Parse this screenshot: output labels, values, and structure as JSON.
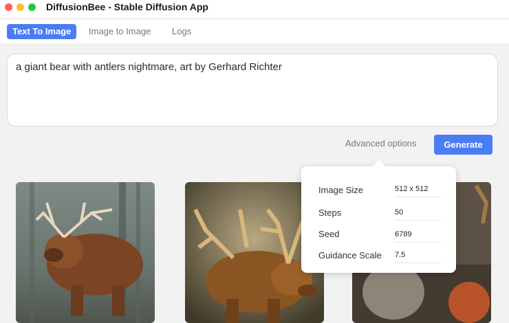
{
  "window": {
    "title": "DiffusionBee - Stable Diffusion App"
  },
  "tabs": [
    {
      "label": "Text To Image",
      "active": true
    },
    {
      "label": "Image to Image",
      "active": false
    },
    {
      "label": "Logs",
      "active": false
    }
  ],
  "prompt": {
    "value": "a giant bear with antlers nightmare, art by Gerhard Richter"
  },
  "controls": {
    "advanced_label": "Advanced options",
    "generate_label": "Generate"
  },
  "advanced": {
    "image_size_label": "Image Size",
    "image_size_value": "512 x 512",
    "steps_label": "Steps",
    "steps_value": "50",
    "seed_label": "Seed",
    "seed_value": "6789",
    "guidance_label": "Guidance Scale",
    "guidance_value": "7.5"
  },
  "colors": {
    "accent": "#4a7cf3"
  }
}
